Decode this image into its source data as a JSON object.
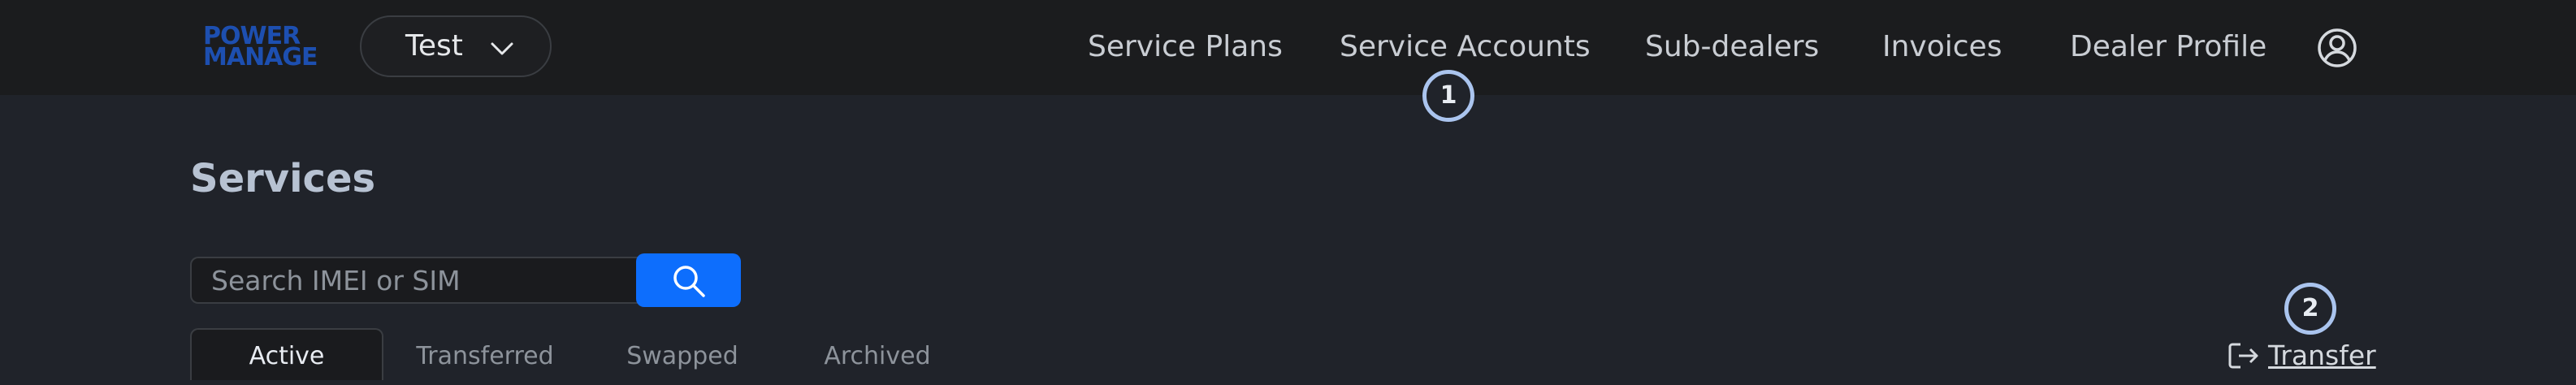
{
  "brand": {
    "logo_line1": "POWER",
    "logo_line2": "MANAGE",
    "color": "#1d4fb0"
  },
  "org_selector": {
    "value": "Test"
  },
  "nav": {
    "items": [
      {
        "label": "Service Plans"
      },
      {
        "label": "Service Accounts"
      },
      {
        "label": "Sub-dealers"
      },
      {
        "label": "Invoices"
      },
      {
        "label": "Dealer Profile"
      }
    ],
    "account_icon": "user-circle-icon"
  },
  "badges": {
    "one": "1",
    "two": "2"
  },
  "page": {
    "title": "Services"
  },
  "search": {
    "placeholder": "Search IMEI or SIM",
    "value": "",
    "button_icon": "search-icon",
    "button_color": "#0d6efd"
  },
  "tabs": [
    {
      "label": "Active",
      "active": true
    },
    {
      "label": "Transferred",
      "active": false
    },
    {
      "label": "Swapped",
      "active": false
    },
    {
      "label": "Archived",
      "active": false
    }
  ],
  "actions": {
    "transfer_label": "Transfer",
    "transfer_icon": "sign-out-icon"
  }
}
